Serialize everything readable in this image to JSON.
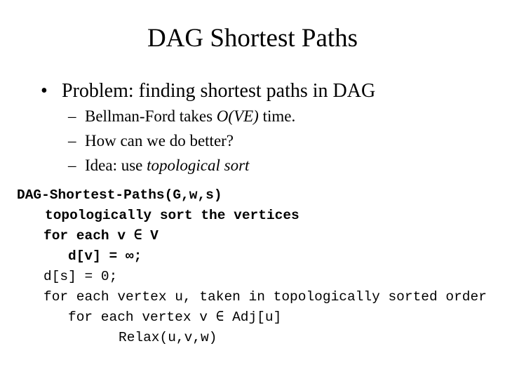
{
  "slide": {
    "title": "DAG Shortest Paths",
    "bullet": {
      "marker": "•",
      "text": "Problem: finding shortest paths in DAG"
    },
    "subbullets": [
      {
        "marker": "–",
        "prefix": "Bellman-Ford takes ",
        "italic": "O(VE)",
        "suffix": " time."
      },
      {
        "marker": "–",
        "prefix": "How can we do better?",
        "italic": "",
        "suffix": ""
      },
      {
        "marker": "–",
        "prefix": "Idea: use ",
        "italic": "topological sort",
        "suffix": ""
      }
    ],
    "code": [
      "DAG-Shortest-Paths(G,w,s)",
      "topologically sort the vertices",
      "for each v ∈ V",
      "d[v] = ∞;",
      "d[s] = 0;",
      "for each vertex u, taken in topologically sorted order",
      "for each vertex v ∈ Adj[u]",
      "Relax(u,v,w)"
    ]
  }
}
